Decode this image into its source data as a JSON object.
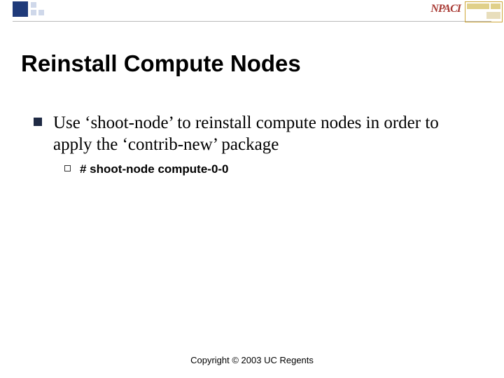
{
  "header": {
    "logo_text": "NPACI"
  },
  "title": "Reinstall Compute Nodes",
  "bullets": {
    "level1": "Use ‘shoot-node’ to reinstall compute nodes in order to apply the ‘contrib-new’ package",
    "level2": "# shoot-node compute-0-0"
  },
  "footer": "Copyright © 2003 UC Regents"
}
